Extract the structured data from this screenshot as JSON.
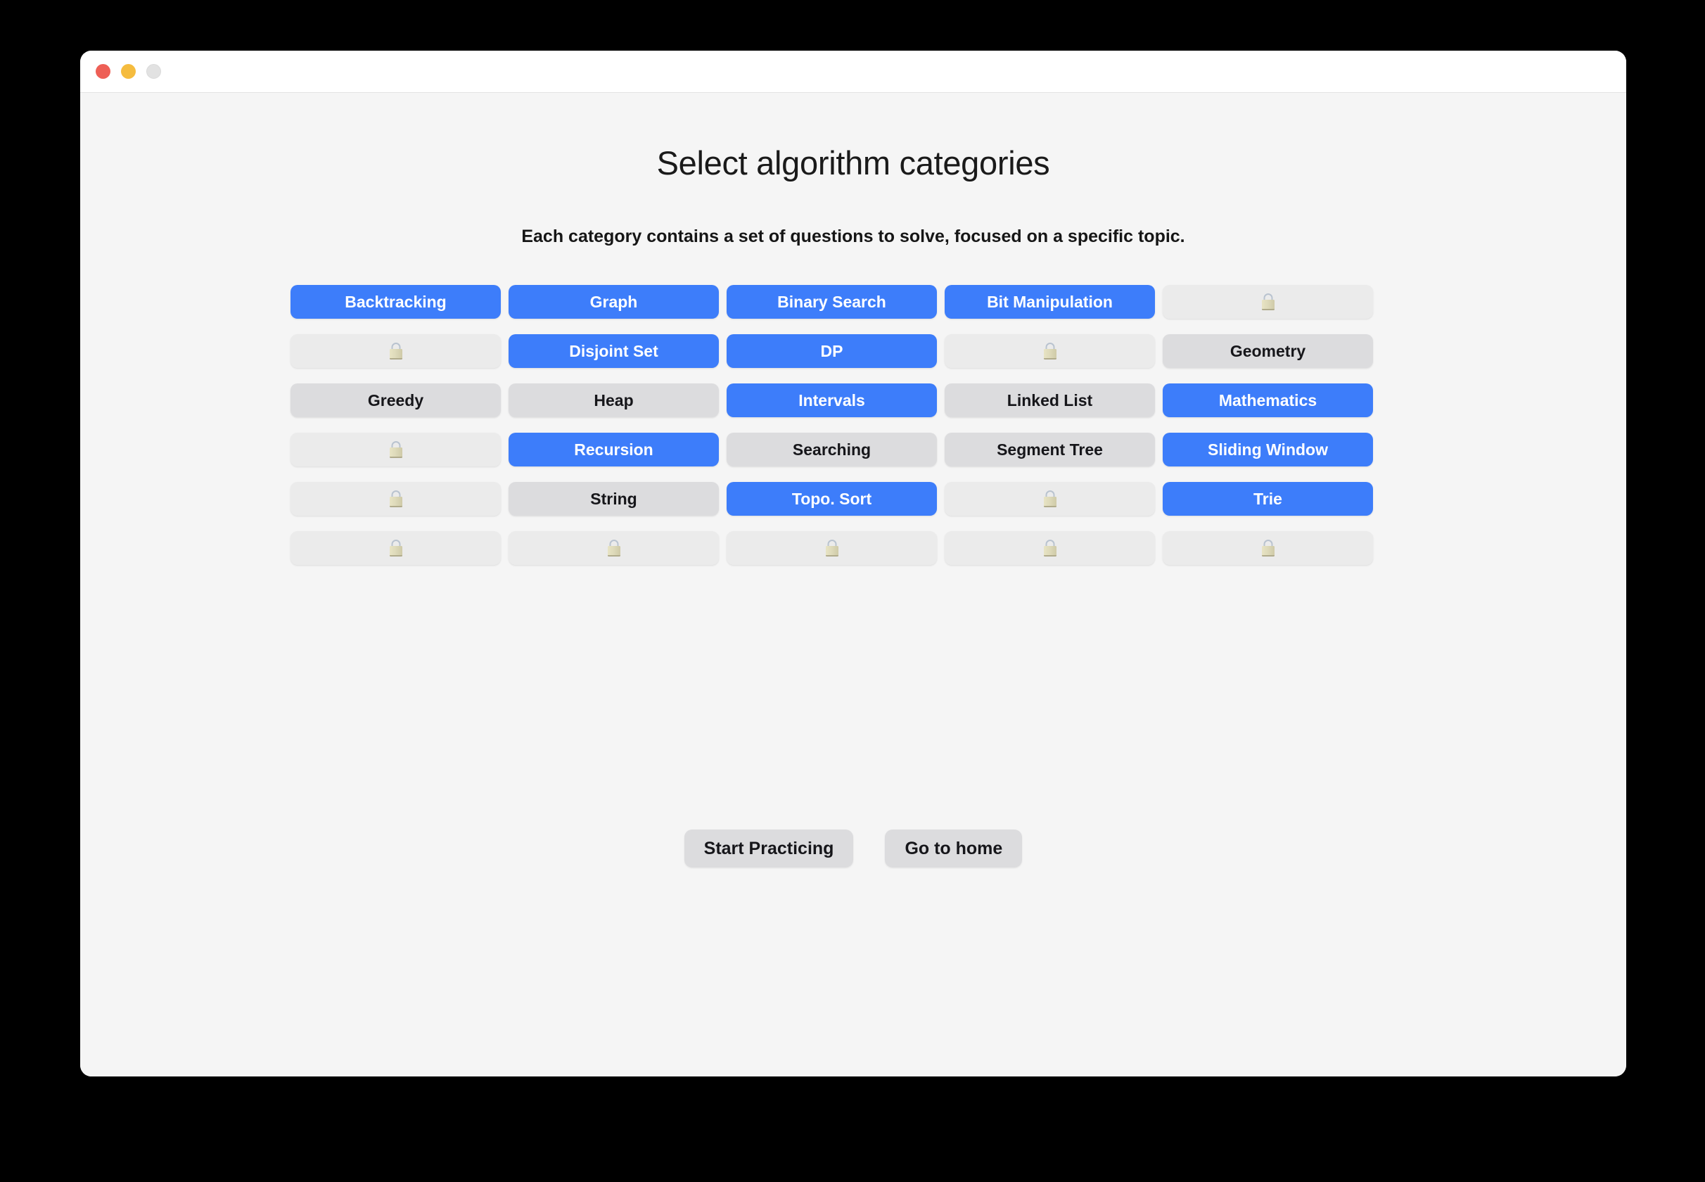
{
  "window": {
    "traffic_lights": [
      {
        "name": "close",
        "color": "#ee5f56"
      },
      {
        "name": "minimize",
        "color": "#f5bc3f"
      },
      {
        "name": "zoom",
        "color": "#e2e2e2"
      }
    ]
  },
  "header": {
    "title": "Select algorithm categories",
    "subtitle": "Each category contains a set of questions to solve, focused on a specific topic."
  },
  "colors": {
    "selected": "#3d7dfa",
    "selected_text": "#ffffff",
    "unselected": "#dcdcde",
    "locked": "#ebebeb",
    "page_background": "#f5f5f5",
    "titlebar": "#ffffff"
  },
  "grid": {
    "columns": 5,
    "rows": 6,
    "lock_icon": "lock-icon",
    "categories": [
      {
        "label": "Backtracking",
        "state": "selected",
        "locked": false
      },
      {
        "label": "Graph",
        "state": "selected",
        "locked": false
      },
      {
        "label": "Binary Search",
        "state": "selected",
        "locked": false
      },
      {
        "label": "Bit Manipulation",
        "state": "selected",
        "locked": false
      },
      {
        "label": "",
        "state": "locked",
        "locked": true
      },
      {
        "label": "",
        "state": "locked",
        "locked": true
      },
      {
        "label": "Disjoint Set",
        "state": "selected",
        "locked": false
      },
      {
        "label": "DP",
        "state": "selected",
        "locked": false
      },
      {
        "label": "",
        "state": "locked",
        "locked": true
      },
      {
        "label": "Geometry",
        "state": "unselected",
        "locked": false
      },
      {
        "label": "Greedy",
        "state": "unselected",
        "locked": false
      },
      {
        "label": "Heap",
        "state": "unselected",
        "locked": false
      },
      {
        "label": "Intervals",
        "state": "selected",
        "locked": false
      },
      {
        "label": "Linked List",
        "state": "unselected",
        "locked": false
      },
      {
        "label": "Mathematics",
        "state": "selected",
        "locked": false
      },
      {
        "label": "",
        "state": "locked",
        "locked": true
      },
      {
        "label": "Recursion",
        "state": "selected",
        "locked": false
      },
      {
        "label": "Searching",
        "state": "unselected",
        "locked": false
      },
      {
        "label": "Segment Tree",
        "state": "unselected",
        "locked": false
      },
      {
        "label": "Sliding Window",
        "state": "selected",
        "locked": false
      },
      {
        "label": "",
        "state": "locked",
        "locked": true
      },
      {
        "label": "String",
        "state": "unselected",
        "locked": false
      },
      {
        "label": "Topo. Sort",
        "state": "selected",
        "locked": false
      },
      {
        "label": "",
        "state": "locked",
        "locked": true
      },
      {
        "label": "Trie",
        "state": "selected",
        "locked": false
      },
      {
        "label": "",
        "state": "locked",
        "locked": true
      },
      {
        "label": "",
        "state": "locked",
        "locked": true
      },
      {
        "label": "",
        "state": "locked",
        "locked": true
      },
      {
        "label": "",
        "state": "locked",
        "locked": true
      },
      {
        "label": "",
        "state": "locked",
        "locked": true
      }
    ]
  },
  "actions": {
    "start_label": "Start Practicing",
    "home_label": "Go to home"
  }
}
